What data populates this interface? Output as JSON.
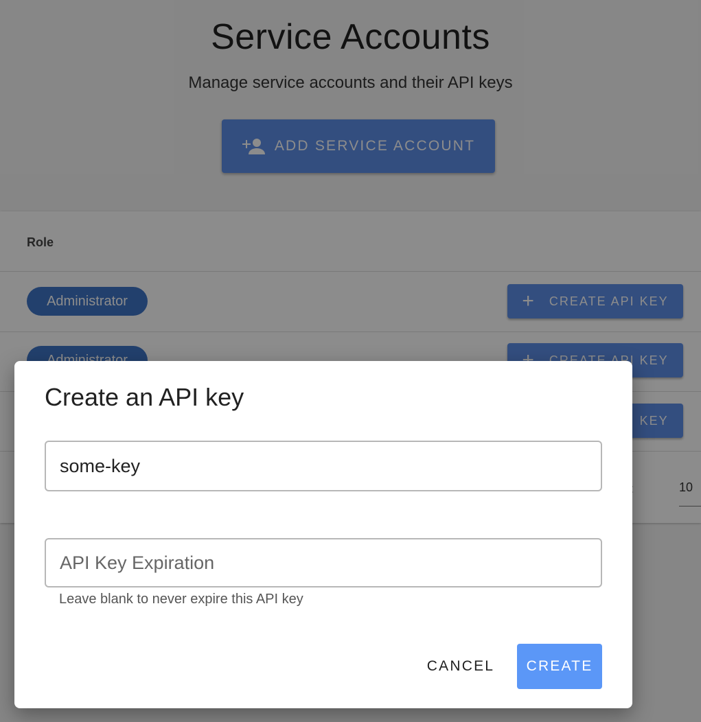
{
  "page": {
    "title": "Service Accounts",
    "subtitle": "Manage service accounts and their API keys",
    "add_button_label": "ADD SERVICE ACCOUNT"
  },
  "table": {
    "header_role": "Role",
    "rows": [
      {
        "role": "Administrator",
        "action_label": "CREATE API KEY"
      },
      {
        "role": "Administrator",
        "action_label": "CREATE API KEY"
      },
      {
        "role": "",
        "action_label": "CREATE API KEY"
      }
    ],
    "pagination": {
      "rows_per_page_label": ":",
      "rows_per_page_value": "10"
    }
  },
  "dialog": {
    "title": "Create an API key",
    "name_value": "some-key",
    "expiration_placeholder": "API Key Expiration",
    "expiration_helper": "Leave blank to never expire this API key",
    "cancel_label": "CANCEL",
    "create_label": "CREATE"
  },
  "colors": {
    "primary": "#5e8fe8",
    "chip": "#3e75c7",
    "create": "#5b97f7"
  }
}
